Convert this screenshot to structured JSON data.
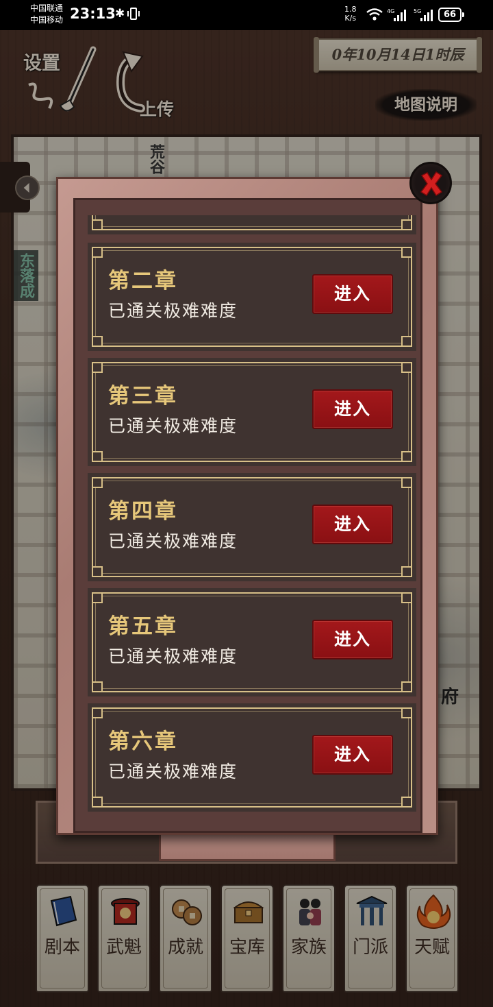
{
  "status_bar": {
    "carrier_1": "中国联通",
    "carrier_2": "中国移动",
    "time": "23:13",
    "net_speed_value": "1.8",
    "net_speed_unit": "K/s",
    "sig1_label": "4G",
    "sig2_label": "5G",
    "battery": "66"
  },
  "hud": {
    "settings_label": "设置",
    "upload_label": "上传",
    "date": "0年10月14日1时辰",
    "map_info_label": "地图说明"
  },
  "map": {
    "label_left": "东落成",
    "label_top": "荒谷",
    "label_right": "府"
  },
  "dialog": {
    "chapters": [
      {
        "title": "第二章",
        "status": "已通关极难难度",
        "button": "进入"
      },
      {
        "title": "第三章",
        "status": "已通关极难难度",
        "button": "进入"
      },
      {
        "title": "第四章",
        "status": "已通关极难难度",
        "button": "进入"
      },
      {
        "title": "第五章",
        "status": "已通关极难难度",
        "button": "进入"
      },
      {
        "title": "第六章",
        "status": "已通关极难难度",
        "button": "进入"
      }
    ],
    "close_icon": "close-x-icon"
  },
  "bottom_nav": [
    {
      "label": "剧本",
      "icon": "book-icon"
    },
    {
      "label": "武魁",
      "icon": "banner-icon"
    },
    {
      "label": "成就",
      "icon": "coins-icon"
    },
    {
      "label": "宝库",
      "icon": "treasure-chest-icon"
    },
    {
      "label": "家族",
      "icon": "family-icon"
    },
    {
      "label": "门派",
      "icon": "gate-icon"
    },
    {
      "label": "天赋",
      "icon": "flame-icon"
    }
  ],
  "colors": {
    "accent_gold": "#e6c77a",
    "button_red": "#9c1619",
    "frame_pink": "#b98e85"
  }
}
